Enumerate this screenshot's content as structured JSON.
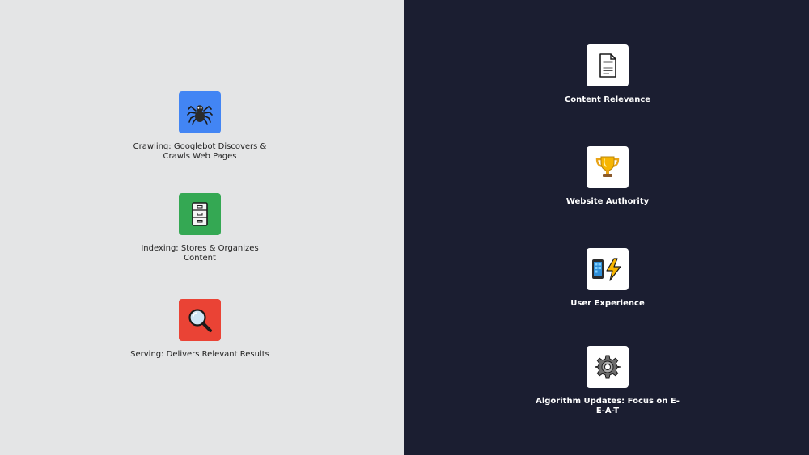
{
  "process": {
    "steps": [
      {
        "label": "Crawling: Googlebot Discovers & Crawls Web Pages",
        "icon": "spider-icon",
        "color": "#4285f4"
      },
      {
        "label": "Indexing: Stores & Organizes Content",
        "icon": "filing-cabinet-icon",
        "color": "#34a853"
      },
      {
        "label": "Serving: Delivers Relevant Results",
        "icon": "magnifying-glass-icon",
        "color": "#ea4335"
      }
    ]
  },
  "factors": {
    "items": [
      {
        "label": "Content Relevance",
        "icon": "document-icon"
      },
      {
        "label": "Website Authority",
        "icon": "trophy-icon"
      },
      {
        "label": "User Experience",
        "icon": "mobile-lightning-icon"
      },
      {
        "label": "Algorithm Updates: Focus on E-E-A-T",
        "icon": "gear-icon"
      }
    ]
  }
}
